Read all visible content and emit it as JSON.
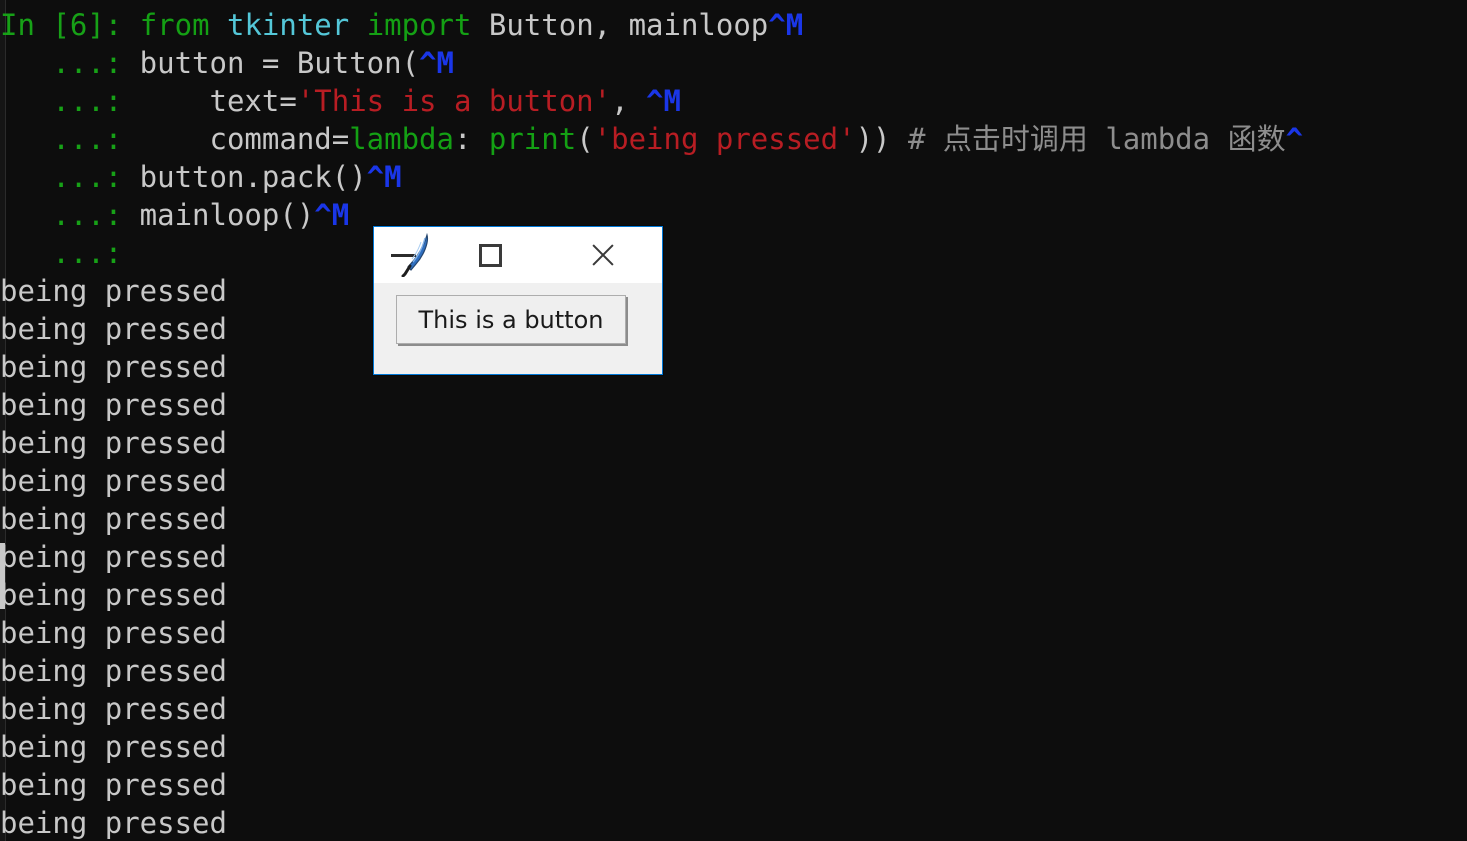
{
  "terminal": {
    "background": "#0d0d0d",
    "foreground": "#c8c8c8",
    "prompt_in": "In [6]:",
    "prompt_cont": "   ...:",
    "colors": {
      "prompt": "#17a117",
      "keyword": "#14a014",
      "module": "#54c7d8",
      "string": "#b81d23",
      "comment": "#8d8d8d",
      "control_char": "#1a36e8",
      "output": "#c8c8c8"
    },
    "code_lines": [
      {
        "prompt": "In [6]:",
        "tokens": [
          {
            "t": " ",
            "c": "plain"
          },
          {
            "t": "from",
            "c": "kw"
          },
          {
            "t": " ",
            "c": "plain"
          },
          {
            "t": "tkinter",
            "c": "mod"
          },
          {
            "t": " ",
            "c": "plain"
          },
          {
            "t": "import",
            "c": "kw"
          },
          {
            "t": " Button, mainloop",
            "c": "plain"
          },
          {
            "t": "^M",
            "c": "ctrl"
          }
        ]
      },
      {
        "prompt": "   ...:",
        "tokens": [
          {
            "t": " button = Button(",
            "c": "plain"
          },
          {
            "t": "^M",
            "c": "ctrl"
          }
        ]
      },
      {
        "prompt": "   ...:",
        "tokens": [
          {
            "t": "     text=",
            "c": "plain"
          },
          {
            "t": "'This is a button'",
            "c": "str"
          },
          {
            "t": ", ",
            "c": "plain"
          },
          {
            "t": "^M",
            "c": "ctrl"
          }
        ]
      },
      {
        "prompt": "   ...:",
        "tokens": [
          {
            "t": "     command=",
            "c": "plain"
          },
          {
            "t": "lambda",
            "c": "kw"
          },
          {
            "t": ": ",
            "c": "plain"
          },
          {
            "t": "print",
            "c": "builtin"
          },
          {
            "t": "(",
            "c": "plain"
          },
          {
            "t": "'being pressed'",
            "c": "str"
          },
          {
            "t": ")) ",
            "c": "plain"
          },
          {
            "t": "# 点击时调用 lambda 函数",
            "c": "comment"
          },
          {
            "t": "^",
            "c": "ctrl"
          }
        ]
      },
      {
        "prompt": "   ...:",
        "tokens": [
          {
            "t": " button.pack()",
            "c": "plain"
          },
          {
            "t": "^M",
            "c": "ctrl"
          }
        ]
      },
      {
        "prompt": "   ...:",
        "tokens": [
          {
            "t": " mainloop()",
            "c": "plain"
          },
          {
            "t": "^M",
            "c": "ctrl"
          }
        ]
      },
      {
        "prompt": "   ...:",
        "tokens": []
      }
    ],
    "output_line": "being pressed",
    "output_count": 15
  },
  "tk_window": {
    "title": "",
    "app_icon": "tk-feather-icon",
    "border_color": "#0078d7",
    "titlebar_background": "#ffffff",
    "body_background": "#f0f0f0",
    "buttons": {
      "minimize": "minimize-icon",
      "maximize": "maximize-icon",
      "close": "close-icon"
    },
    "widget_button_label": "This is a button"
  }
}
